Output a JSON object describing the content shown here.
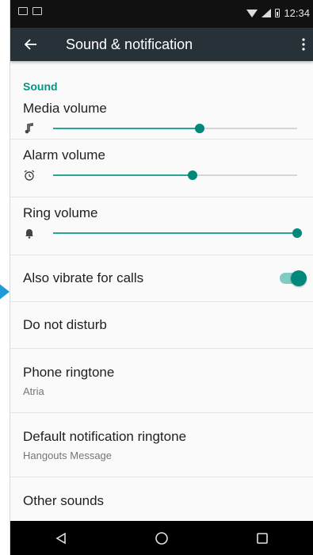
{
  "status_bar": {
    "time": "12:34"
  },
  "app_bar": {
    "title": "Sound & notification"
  },
  "section": {
    "sound_header": "Sound"
  },
  "sliders": [
    {
      "label": "Media volume",
      "icon": "music-note-icon",
      "level": 0.6
    },
    {
      "label": "Alarm volume",
      "icon": "alarm-clock-icon",
      "level": 0.57
    },
    {
      "label": "Ring volume",
      "icon": "bell-icon",
      "level": 1.0
    }
  ],
  "vibrate": {
    "label": "Also vibrate for calls",
    "enabled": true
  },
  "items": [
    {
      "title": "Do not disturb"
    },
    {
      "title": "Phone ringtone",
      "subtitle": "Atria"
    },
    {
      "title": "Default notification ringtone",
      "subtitle": "Hangouts Message"
    },
    {
      "title": "Other sounds"
    }
  ],
  "colors": {
    "accent": "#009688",
    "thumb": "#00897b",
    "appbar": "#263238"
  }
}
